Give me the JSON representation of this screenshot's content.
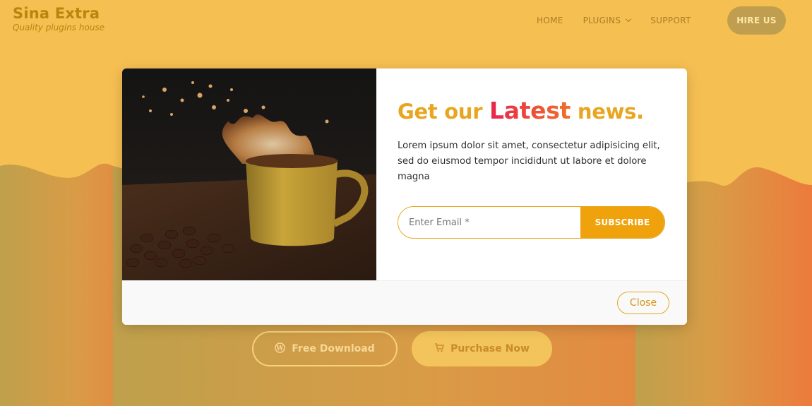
{
  "brand": {
    "name": "Sina Extra",
    "tagline": "Quality plugins house"
  },
  "nav": {
    "items": [
      {
        "label": "HOME"
      },
      {
        "label": "PLUGINS"
      },
      {
        "label": "SUPPORT"
      }
    ],
    "cta_label": "HIRE US"
  },
  "hero_buttons": {
    "free_label": "Free Download",
    "free_icon": "wordpress-icon",
    "purchase_label": "Purchase Now",
    "purchase_icon": "cart-icon"
  },
  "modal": {
    "headline_before": "Get our ",
    "headline_highlight": "Latest",
    "headline_after": " news.",
    "body": "Lorem ipsum dolor sit amet, consectetur adipisicing elit, sed do eiusmod tempor incididunt ut labore et dolore magna",
    "email_placeholder": "Enter Email *",
    "email_value": "",
    "subscribe_label": "SUBSCRIBE",
    "close_label": "Close",
    "image": "coffee-cup-splash-photo"
  },
  "colors": {
    "accent": "#e8a620",
    "highlight_start": "#e8254b",
    "highlight_end": "#f0702a",
    "background_top": "#f6bf52",
    "background_bottom": "#e87a3e"
  }
}
